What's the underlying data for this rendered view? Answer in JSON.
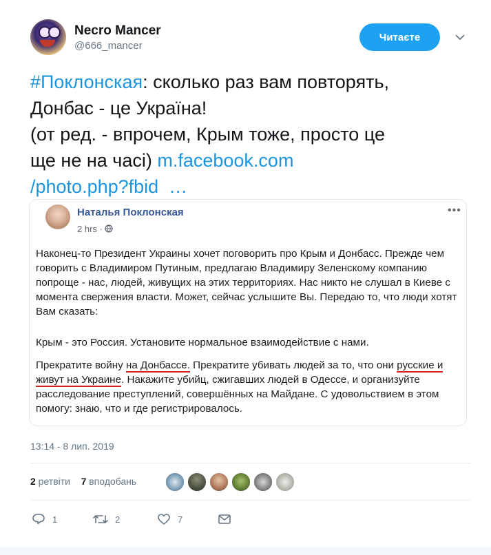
{
  "author": {
    "display_name": "Necro Mancer",
    "handle": "@666_mancer",
    "follow_label": "Читаєте"
  },
  "tweet": {
    "hashtag": "#Поклонская",
    "text_after_hashtag": ": сколько раз вам повторять,\nДонбас - це Україна!\n(от ред. - впрочем, Крым тоже, просто це\nще не на часі) ",
    "link_part1": "m.facebook.com",
    "link_part2": "/photo.php?fbid",
    "link_ellipsis": "  …"
  },
  "embed": {
    "name": "Наталья Поклонская",
    "time": "2 hrs · ",
    "p1": "Наконец-то Президент Украины хочет поговорить про Крым и Донбасс. Прежде чем говорить с Владимиром Путиным, предлагаю Владимиру Зеленскому компанию попроще - нас, людей, живущих на этих территориях. Нас никто не слушал в Киеве с момента свержения власти. Может, сейчас услышите Вы. Передаю то, что люди хотят Вам сказать:",
    "p2": "Крым - это Россия. Установите нормальное взаимодействие с нами.",
    "p3_a": "Прекратите войну ",
    "p3_u1": "на Донбассе.",
    "p3_b": " Прекратите убивать людей за то, что они ",
    "p3_u2": "русские и живут на Украине",
    "p3_c": ". Накажите убийц, сжигавших людей в Одессе, и организуйте расследование преступлений, совершённых на Майдане. С удовольствием в этом помогу: знаю, что и где регистрировалось."
  },
  "timestamp": "13:14 - 8 лип. 2019",
  "stats": {
    "retweets_count": "2",
    "retweets_label": " ретвіти",
    "likes_count": "7",
    "likes_label": " вподобань"
  },
  "actions": {
    "reply_count": "1",
    "retweet_count": "2",
    "like_count": "7"
  },
  "colors": {
    "accent": "#1da1f2",
    "link": "#1b95e0",
    "facebook_name": "#385898",
    "underline": "#d21f1f"
  }
}
